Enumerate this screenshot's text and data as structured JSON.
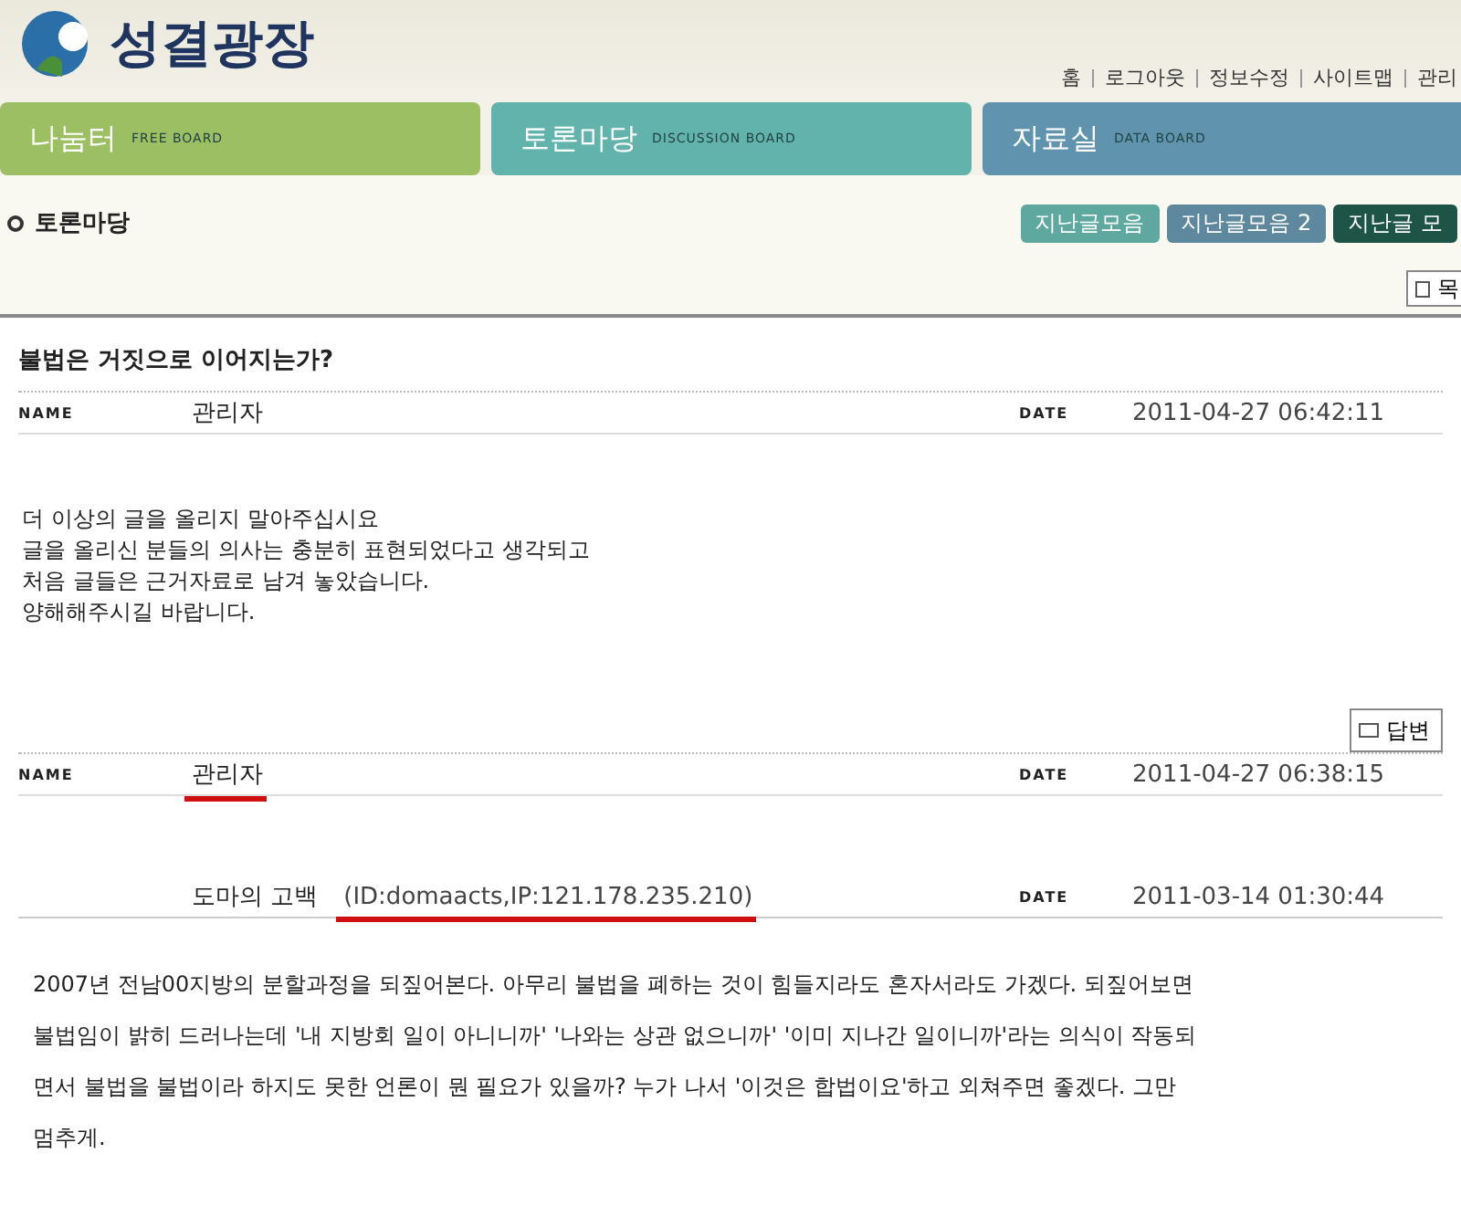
{
  "site": {
    "logo_text": "성결광장"
  },
  "top_links": [
    "홈",
    "로그아웃",
    "정보수정",
    "사이트맵",
    "관리"
  ],
  "nav_tabs": [
    {
      "label": "나눔터",
      "sub": "FREE BOARD",
      "color": "#9dbf63"
    },
    {
      "label": "토론마당",
      "sub": "DISCUSSION BOARD",
      "color": "#62b3ab"
    },
    {
      "label": "자료실",
      "sub": "DATA BOARD",
      "color": "#5f93ae"
    }
  ],
  "section_title": "토론마당",
  "archive_buttons": [
    {
      "label": "지난글모음",
      "color": "#5ea8a0"
    },
    {
      "label": "지난글모음 2",
      "color": "#5e889e"
    },
    {
      "label": "지난글 모",
      "color": "#1d5446"
    }
  ],
  "list_button": "목",
  "post": {
    "title": "불법은 거짓으로 이어지는가?",
    "name_label": "NAME",
    "name": "관리자",
    "date_label": "DATE",
    "date": "2011-04-27 06:42:11",
    "body": [
      "더 이상의 글을 올리지 말아주십시요",
      "글을 올리신 분들의 의사는 충분히 표현되었다고 생각되고",
      "처음 글들은 근거자료로 남겨 놓았습니다.",
      "양해해주시길 바랍니다."
    ],
    "reply_button": "답변"
  },
  "comments": [
    {
      "name_label": "NAME",
      "name": "관리자",
      "date_label": "DATE",
      "date": "2011-04-27 06:38:15",
      "name_underlined": true
    },
    {
      "name": "도마의 고백",
      "info": "(ID:domaacts,IP:121.178.235.210)",
      "date_label": "DATE",
      "date": "2011-03-14 01:30:44",
      "name_underlined": false,
      "info_underlined": true
    }
  ],
  "quoted_text": "2007년 전남00지방의 분할과정을 되짚어본다. 아무리 불법을 폐하는 것이 힘들지라도 혼자서라도 가겠다. 되짚어보면 불법임이 밝히 드러나는데  '내 지방회 일이 아니니까' '나와는 상관 없으니까' '이미 지나간 일이니까'라는 의식이 작동되면서 불법을 불법이라 하지도 못한 언론이 뭔 필요가 있을까? 누가 나서 '이것은 합법이요'하고 외쳐주면 좋겠다. 그만 멈추게."
}
